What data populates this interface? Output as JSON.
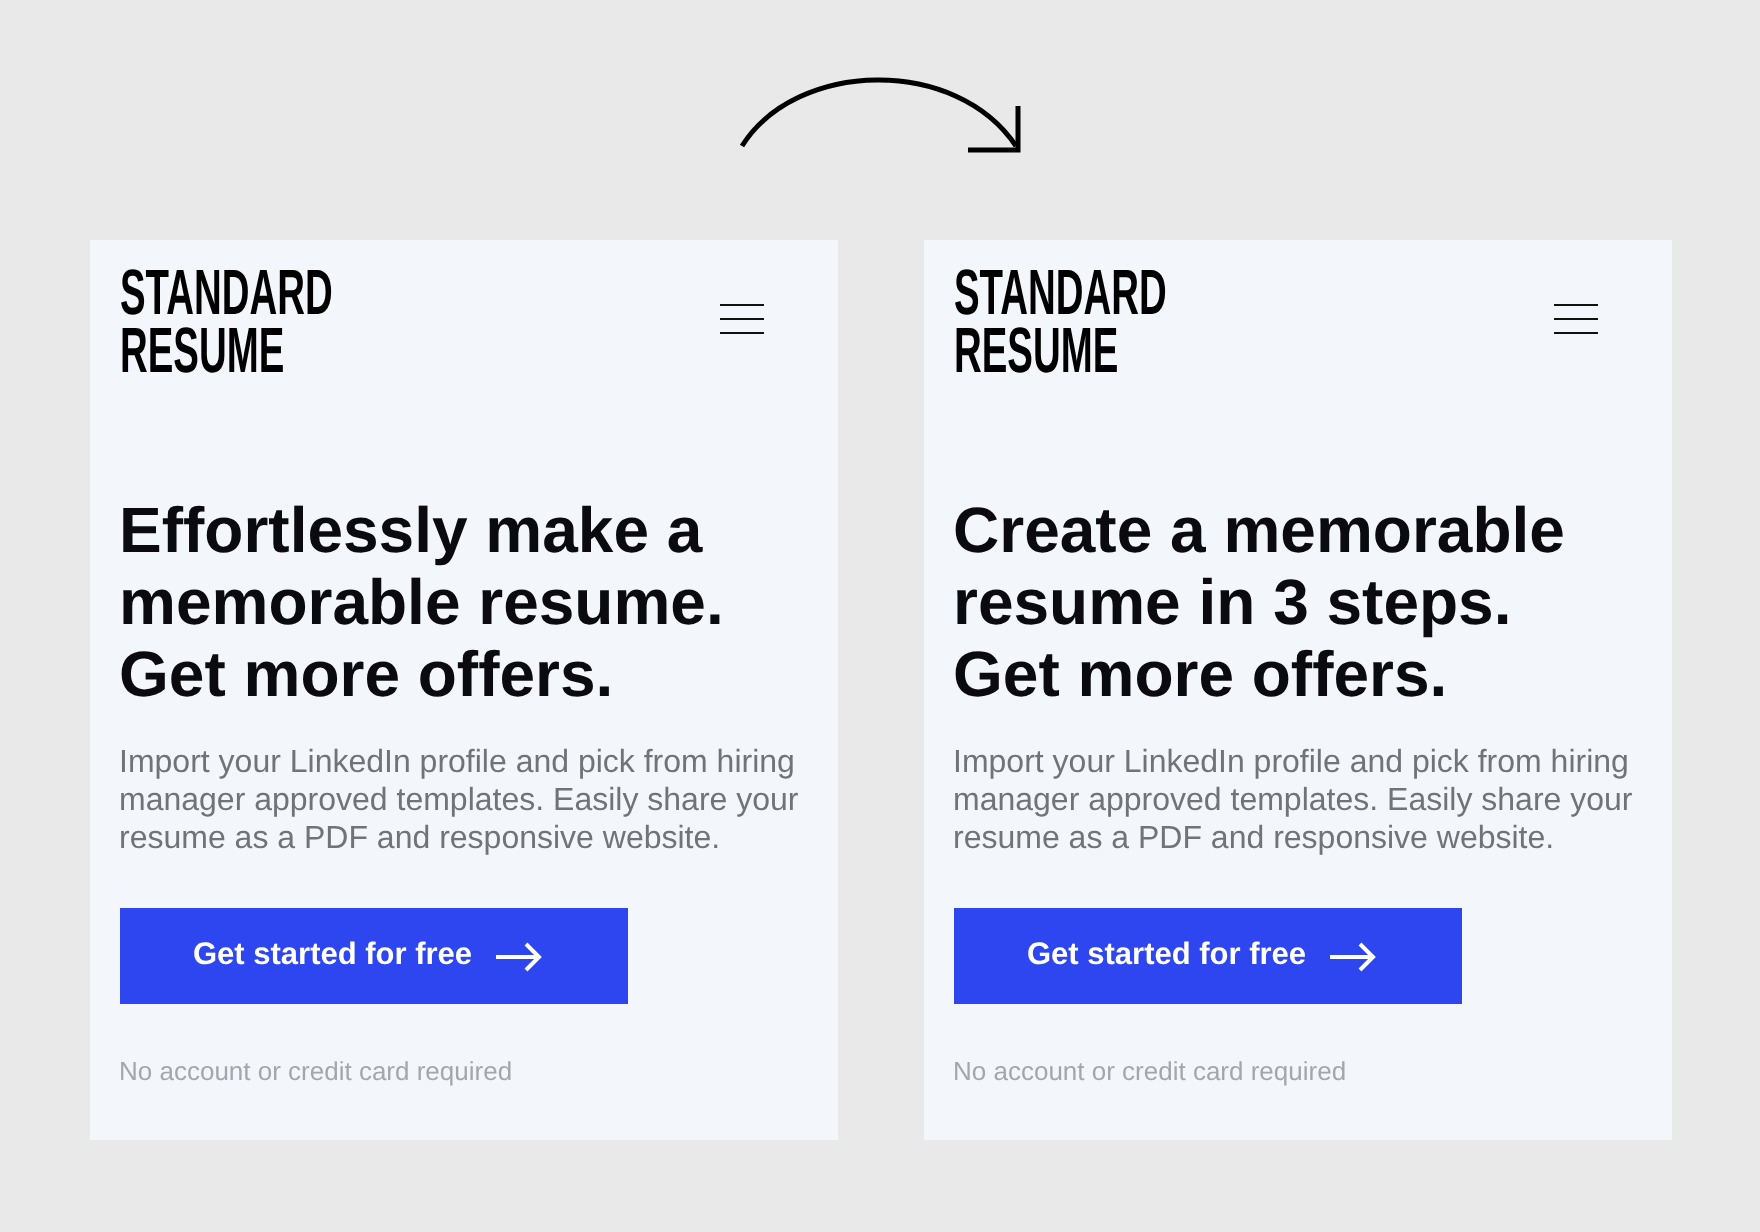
{
  "cards": [
    {
      "logo": "STANDARD RESUME",
      "headline": "Effortlessly make a memorable resume. Get more offers.",
      "description": "Import your LinkedIn profile and pick from hiring manager approved templates. Easily share your resume as a PDF and responsive website.",
      "cta": "Get started for free",
      "note": "No account or credit card required"
    },
    {
      "logo": "STANDARD RESUME",
      "headline": "Create a memorable resume in 3 steps. Get more offers.",
      "description": "Import your LinkedIn profile and pick from hiring manager approved templates. Easily share your resume as a PDF and responsive website.",
      "cta": "Get started for free",
      "note": "No account or credit card required"
    }
  ]
}
